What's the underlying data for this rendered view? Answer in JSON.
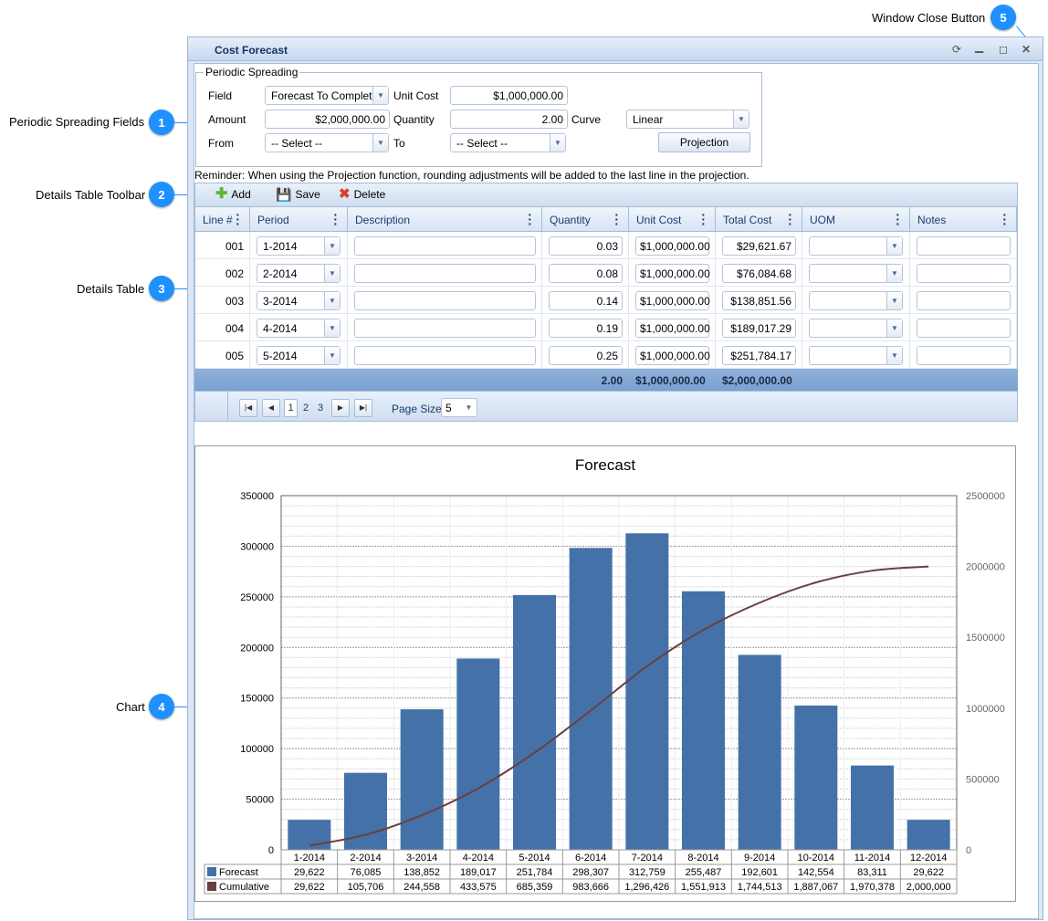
{
  "callouts": [
    {
      "num": "1",
      "label": "Periodic Spreading Fields"
    },
    {
      "num": "2",
      "label": "Details Table Toolbar"
    },
    {
      "num": "3",
      "label": "Details Table"
    },
    {
      "num": "4",
      "label": "Chart"
    },
    {
      "num": "5",
      "label": "Window Close Button"
    }
  ],
  "window": {
    "title": "Cost Forecast",
    "icons": [
      "refresh-icon",
      "minimize-icon",
      "maximize-icon",
      "close-icon"
    ]
  },
  "spreading": {
    "legend": "Periodic Spreading",
    "field_label": "Field",
    "field_value": "Forecast To Complet",
    "unit_cost_label": "Unit Cost",
    "unit_cost_value": "$1,000,000.00",
    "amount_label": "Amount",
    "amount_value": "$2,000,000.00",
    "quantity_label": "Quantity",
    "quantity_value": "2.00",
    "curve_label": "Curve",
    "curve_value": "Linear",
    "from_label": "From",
    "from_value": "-- Select --",
    "to_label": "To",
    "to_value": "-- Select --",
    "projection_button": "Projection"
  },
  "reminder": "Reminder: When using the Projection function, rounding adjustments will be added to the last line in the projection.",
  "toolbar": {
    "add": "Add",
    "save": "Save",
    "delete": "Delete"
  },
  "table": {
    "columns": [
      "Line #",
      "Period",
      "Description",
      "Quantity",
      "Unit Cost",
      "Total Cost",
      "UOM",
      "Notes"
    ],
    "rows": [
      {
        "line": "001",
        "period": "1-2014",
        "description": "",
        "quantity": "0.03",
        "unit_cost": "$1,000,000.00",
        "total_cost": "$29,621.67",
        "uom": "",
        "notes": ""
      },
      {
        "line": "002",
        "period": "2-2014",
        "description": "",
        "quantity": "0.08",
        "unit_cost": "$1,000,000.00",
        "total_cost": "$76,084.68",
        "uom": "",
        "notes": ""
      },
      {
        "line": "003",
        "period": "3-2014",
        "description": "",
        "quantity": "0.14",
        "unit_cost": "$1,000,000.00",
        "total_cost": "$138,851.56",
        "uom": "",
        "notes": ""
      },
      {
        "line": "004",
        "period": "4-2014",
        "description": "",
        "quantity": "0.19",
        "unit_cost": "$1,000,000.00",
        "total_cost": "$189,017.29",
        "uom": "",
        "notes": ""
      },
      {
        "line": "005",
        "period": "5-2014",
        "description": "",
        "quantity": "0.25",
        "unit_cost": "$1,000,000.00",
        "total_cost": "$251,784.17",
        "uom": "",
        "notes": ""
      }
    ],
    "totals": {
      "quantity": "2.00",
      "unit_cost": "$1,000,000.00",
      "total_cost": "$2,000,000.00"
    },
    "pager": {
      "pages": [
        "1",
        "2",
        "3"
      ],
      "current": "1",
      "page_size_label": "Page Size",
      "page_size": "5"
    }
  },
  "chart_data": {
    "type": "bar",
    "title": "Forecast",
    "categories": [
      "1-2014",
      "2-2014",
      "3-2014",
      "4-2014",
      "5-2014",
      "6-2014",
      "7-2014",
      "8-2014",
      "9-2014",
      "10-2014",
      "11-2014",
      "12-2014"
    ],
    "series": [
      {
        "name": "Forecast",
        "type": "bar",
        "axis": "left",
        "color": "#4472a8",
        "values": [
          29622,
          76085,
          138852,
          189017,
          251784,
          298307,
          312759,
          255487,
          192601,
          142554,
          83311,
          29622
        ],
        "labels": [
          "29,622",
          "76,085",
          "138,852",
          "189,017",
          "251,784",
          "298,307",
          "312,759",
          "255,487",
          "192,601",
          "142,554",
          "83,311",
          "29,622"
        ]
      },
      {
        "name": "Cumulative",
        "type": "line",
        "axis": "right",
        "color": "#6b3f3f",
        "values": [
          29622,
          105706,
          244558,
          433575,
          685359,
          983666,
          1296426,
          1551913,
          1744513,
          1887067,
          1970378,
          2000000
        ],
        "labels": [
          "29,622",
          "105,706",
          "244,558",
          "433,575",
          "685,359",
          "983,666",
          "1,296,426",
          "1,551,913",
          "1,744,513",
          "1,887,067",
          "1,970,378",
          "2,000,000"
        ]
      }
    ],
    "ylim_left": [
      0,
      350000
    ],
    "yticks_left": [
      "0",
      "50000",
      "100000",
      "150000",
      "200000",
      "250000",
      "300000",
      "350000"
    ],
    "ylim_right": [
      0,
      2500000
    ],
    "yticks_right": [
      "0",
      "500000",
      "1000000",
      "1500000",
      "2000000",
      "2500000"
    ],
    "grid": true,
    "legend": "data-table-below"
  }
}
